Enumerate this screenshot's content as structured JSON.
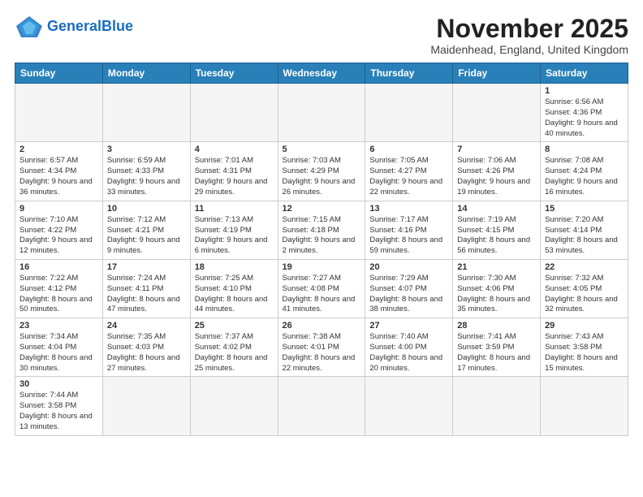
{
  "header": {
    "logo_general": "General",
    "logo_blue": "Blue",
    "month_title": "November 2025",
    "location": "Maidenhead, England, United Kingdom"
  },
  "days_of_week": [
    "Sunday",
    "Monday",
    "Tuesday",
    "Wednesday",
    "Thursday",
    "Friday",
    "Saturday"
  ],
  "weeks": [
    [
      {
        "day": "",
        "info": ""
      },
      {
        "day": "",
        "info": ""
      },
      {
        "day": "",
        "info": ""
      },
      {
        "day": "",
        "info": ""
      },
      {
        "day": "",
        "info": ""
      },
      {
        "day": "",
        "info": ""
      },
      {
        "day": "1",
        "info": "Sunrise: 6:56 AM\nSunset: 4:36 PM\nDaylight: 9 hours and 40 minutes."
      }
    ],
    [
      {
        "day": "2",
        "info": "Sunrise: 6:57 AM\nSunset: 4:34 PM\nDaylight: 9 hours and 36 minutes."
      },
      {
        "day": "3",
        "info": "Sunrise: 6:59 AM\nSunset: 4:33 PM\nDaylight: 9 hours and 33 minutes."
      },
      {
        "day": "4",
        "info": "Sunrise: 7:01 AM\nSunset: 4:31 PM\nDaylight: 9 hours and 29 minutes."
      },
      {
        "day": "5",
        "info": "Sunrise: 7:03 AM\nSunset: 4:29 PM\nDaylight: 9 hours and 26 minutes."
      },
      {
        "day": "6",
        "info": "Sunrise: 7:05 AM\nSunset: 4:27 PM\nDaylight: 9 hours and 22 minutes."
      },
      {
        "day": "7",
        "info": "Sunrise: 7:06 AM\nSunset: 4:26 PM\nDaylight: 9 hours and 19 minutes."
      },
      {
        "day": "8",
        "info": "Sunrise: 7:08 AM\nSunset: 4:24 PM\nDaylight: 9 hours and 16 minutes."
      }
    ],
    [
      {
        "day": "9",
        "info": "Sunrise: 7:10 AM\nSunset: 4:22 PM\nDaylight: 9 hours and 12 minutes."
      },
      {
        "day": "10",
        "info": "Sunrise: 7:12 AM\nSunset: 4:21 PM\nDaylight: 9 hours and 9 minutes."
      },
      {
        "day": "11",
        "info": "Sunrise: 7:13 AM\nSunset: 4:19 PM\nDaylight: 9 hours and 6 minutes."
      },
      {
        "day": "12",
        "info": "Sunrise: 7:15 AM\nSunset: 4:18 PM\nDaylight: 9 hours and 2 minutes."
      },
      {
        "day": "13",
        "info": "Sunrise: 7:17 AM\nSunset: 4:16 PM\nDaylight: 8 hours and 59 minutes."
      },
      {
        "day": "14",
        "info": "Sunrise: 7:19 AM\nSunset: 4:15 PM\nDaylight: 8 hours and 56 minutes."
      },
      {
        "day": "15",
        "info": "Sunrise: 7:20 AM\nSunset: 4:14 PM\nDaylight: 8 hours and 53 minutes."
      }
    ],
    [
      {
        "day": "16",
        "info": "Sunrise: 7:22 AM\nSunset: 4:12 PM\nDaylight: 8 hours and 50 minutes."
      },
      {
        "day": "17",
        "info": "Sunrise: 7:24 AM\nSunset: 4:11 PM\nDaylight: 8 hours and 47 minutes."
      },
      {
        "day": "18",
        "info": "Sunrise: 7:25 AM\nSunset: 4:10 PM\nDaylight: 8 hours and 44 minutes."
      },
      {
        "day": "19",
        "info": "Sunrise: 7:27 AM\nSunset: 4:08 PM\nDaylight: 8 hours and 41 minutes."
      },
      {
        "day": "20",
        "info": "Sunrise: 7:29 AM\nSunset: 4:07 PM\nDaylight: 8 hours and 38 minutes."
      },
      {
        "day": "21",
        "info": "Sunrise: 7:30 AM\nSunset: 4:06 PM\nDaylight: 8 hours and 35 minutes."
      },
      {
        "day": "22",
        "info": "Sunrise: 7:32 AM\nSunset: 4:05 PM\nDaylight: 8 hours and 32 minutes."
      }
    ],
    [
      {
        "day": "23",
        "info": "Sunrise: 7:34 AM\nSunset: 4:04 PM\nDaylight: 8 hours and 30 minutes."
      },
      {
        "day": "24",
        "info": "Sunrise: 7:35 AM\nSunset: 4:03 PM\nDaylight: 8 hours and 27 minutes."
      },
      {
        "day": "25",
        "info": "Sunrise: 7:37 AM\nSunset: 4:02 PM\nDaylight: 8 hours and 25 minutes."
      },
      {
        "day": "26",
        "info": "Sunrise: 7:38 AM\nSunset: 4:01 PM\nDaylight: 8 hours and 22 minutes."
      },
      {
        "day": "27",
        "info": "Sunrise: 7:40 AM\nSunset: 4:00 PM\nDaylight: 8 hours and 20 minutes."
      },
      {
        "day": "28",
        "info": "Sunrise: 7:41 AM\nSunset: 3:59 PM\nDaylight: 8 hours and 17 minutes."
      },
      {
        "day": "29",
        "info": "Sunrise: 7:43 AM\nSunset: 3:58 PM\nDaylight: 8 hours and 15 minutes."
      }
    ],
    [
      {
        "day": "30",
        "info": "Sunrise: 7:44 AM\nSunset: 3:58 PM\nDaylight: 8 hours and 13 minutes."
      },
      {
        "day": "",
        "info": ""
      },
      {
        "day": "",
        "info": ""
      },
      {
        "day": "",
        "info": ""
      },
      {
        "day": "",
        "info": ""
      },
      {
        "day": "",
        "info": ""
      },
      {
        "day": "",
        "info": ""
      }
    ]
  ]
}
